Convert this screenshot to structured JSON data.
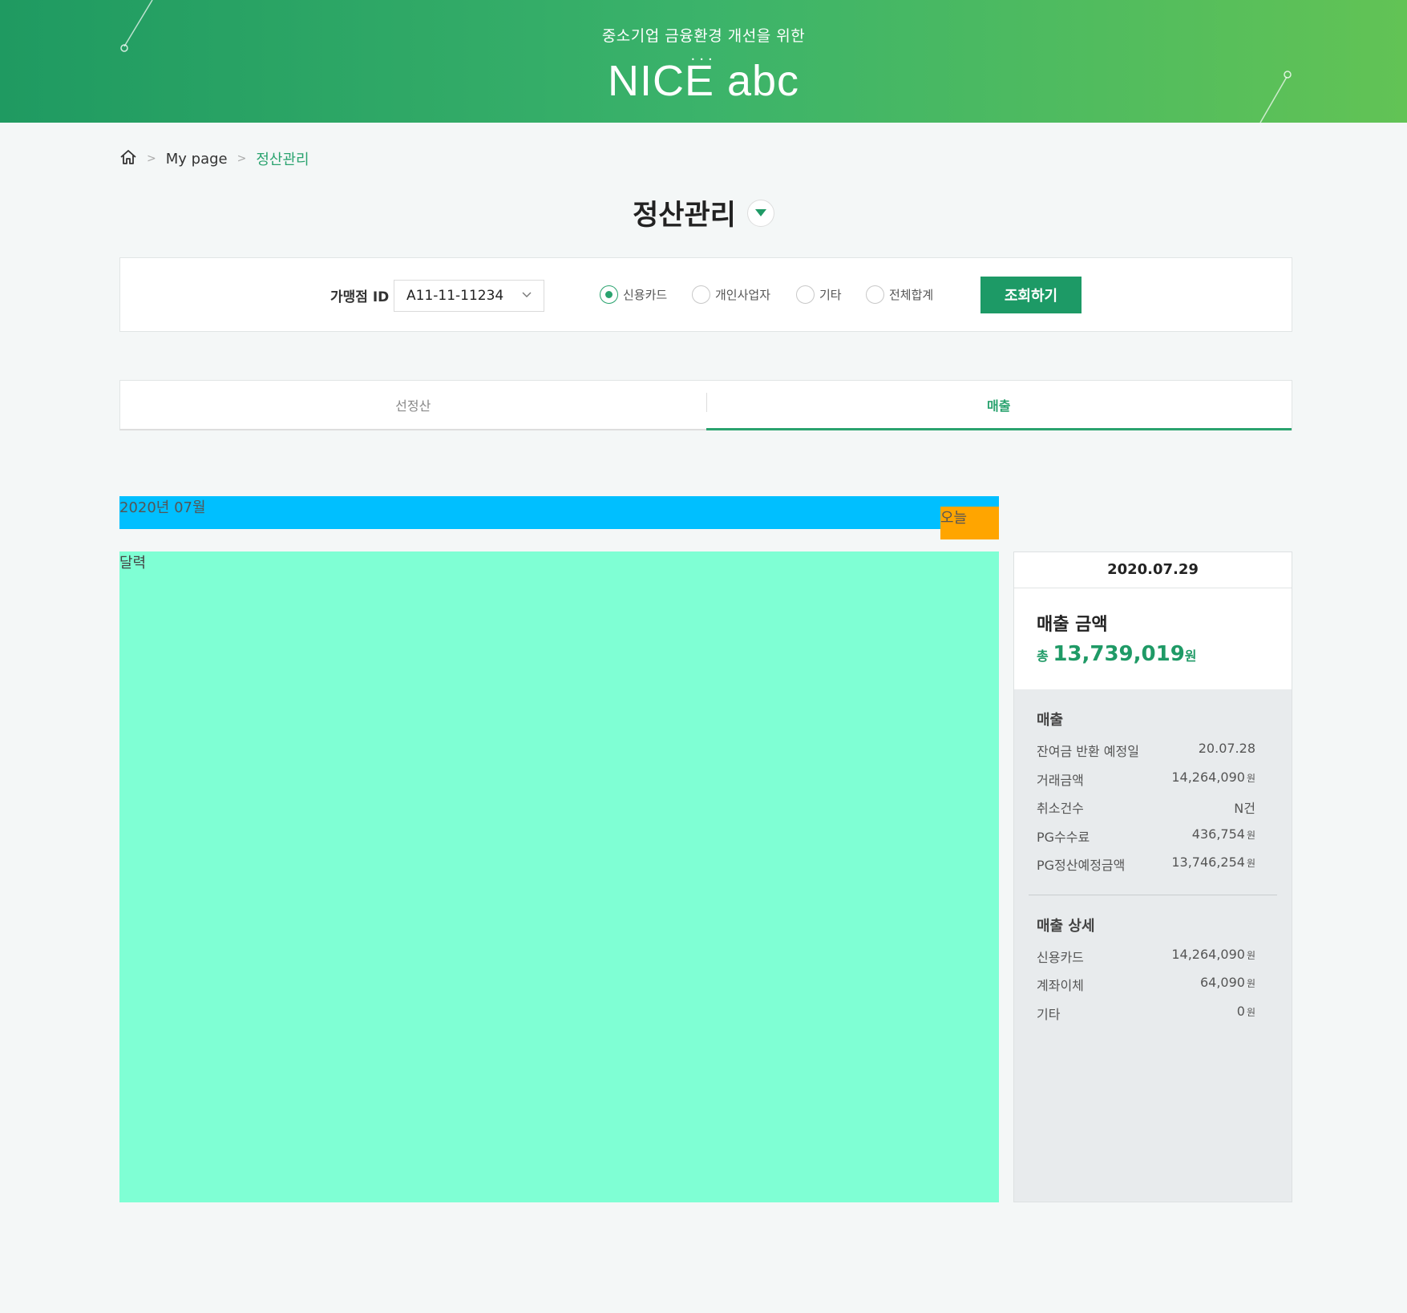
{
  "header": {
    "subtitle": "중소기업 금융환경 개선을 위한",
    "title": "NICE abc",
    "brand_color": "#2aa36f"
  },
  "breadcrumb": {
    "home_icon": "home-icon",
    "items": [
      "My page",
      "정산관리"
    ]
  },
  "page": {
    "title": "정산관리"
  },
  "filter": {
    "merchant_label": "가맹점 ID",
    "merchant_value": "A11-11-11234",
    "radios": [
      {
        "label": "신용카드",
        "checked": true
      },
      {
        "label": "개인사업자",
        "checked": false
      },
      {
        "label": "기타",
        "checked": false
      },
      {
        "label": "전체합계",
        "checked": false
      }
    ],
    "search_label": "조회하기"
  },
  "tabs": [
    {
      "label": "선정산",
      "active": false
    },
    {
      "label": "매출",
      "active": true
    }
  ],
  "calendar": {
    "month": "2020년 07월",
    "today": "오늘",
    "label": "달력"
  },
  "side": {
    "date": "2020.07.29",
    "summary_title": "매출 금액",
    "total_prefix": "총",
    "total_amount": "13,739,019",
    "total_unit": "원",
    "sales": {
      "title": "매출",
      "rows": [
        {
          "label": "잔여금 반환 예정일",
          "value": "20.07.28",
          "unit": ""
        },
        {
          "label": "거래금액",
          "value": "14,264,090",
          "unit": "원"
        },
        {
          "label": "취소건수",
          "value": "N건",
          "unit": ""
        },
        {
          "label": "PG수수료",
          "value": "436,754",
          "unit": "원"
        },
        {
          "label": "PG정산예정금액",
          "value": "13,746,254",
          "unit": "원"
        }
      ]
    },
    "detail": {
      "title": "매출 상세",
      "rows": [
        {
          "label": "신용카드",
          "value": "14,264,090",
          "unit": "원"
        },
        {
          "label": "계좌이체",
          "value": "64,090",
          "unit": "원"
        },
        {
          "label": "기타",
          "value": "0",
          "unit": "원"
        }
      ]
    }
  }
}
